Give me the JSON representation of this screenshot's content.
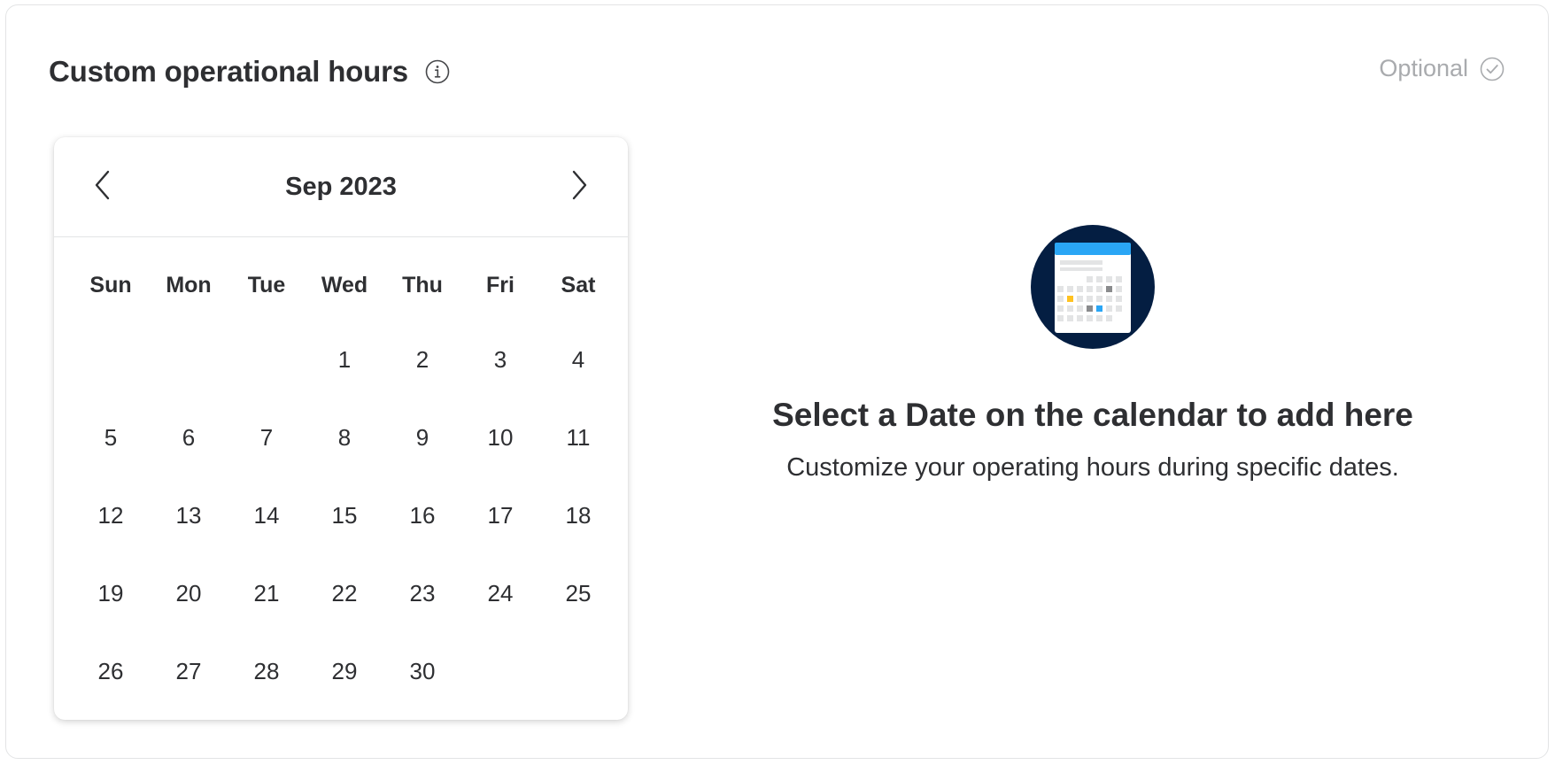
{
  "section": {
    "title": "Custom operational hours",
    "optional_label": "Optional"
  },
  "icons": {
    "info": "info-icon",
    "check": "check-circle-icon",
    "prev": "chevron-left-icon",
    "next": "chevron-right-icon",
    "illustration": "calendar-illustration-icon"
  },
  "calendar": {
    "month_label": "Sep 2023",
    "weekdays": [
      "Sun",
      "Mon",
      "Tue",
      "Wed",
      "Thu",
      "Fri",
      "Sat"
    ],
    "weeks": [
      [
        "",
        "",
        "",
        "1",
        "2",
        "3",
        "4"
      ],
      [
        "5",
        "6",
        "7",
        "8",
        "9",
        "10",
        "11"
      ],
      [
        "12",
        "13",
        "14",
        "15",
        "16",
        "17",
        "18"
      ],
      [
        "19",
        "20",
        "21",
        "22",
        "23",
        "24",
        "25"
      ],
      [
        "26",
        "27",
        "28",
        "29",
        "30",
        "",
        ""
      ]
    ]
  },
  "empty_state": {
    "title": "Select a Date on the calendar to add here",
    "subtitle": "Customize your operating hours during specific dates."
  },
  "colors": {
    "text": "#2e2f32",
    "muted": "#a9abae",
    "illustration_bg": "#041e42",
    "accent_blue": "#2aa6f5",
    "accent_yellow": "#ffc220"
  }
}
